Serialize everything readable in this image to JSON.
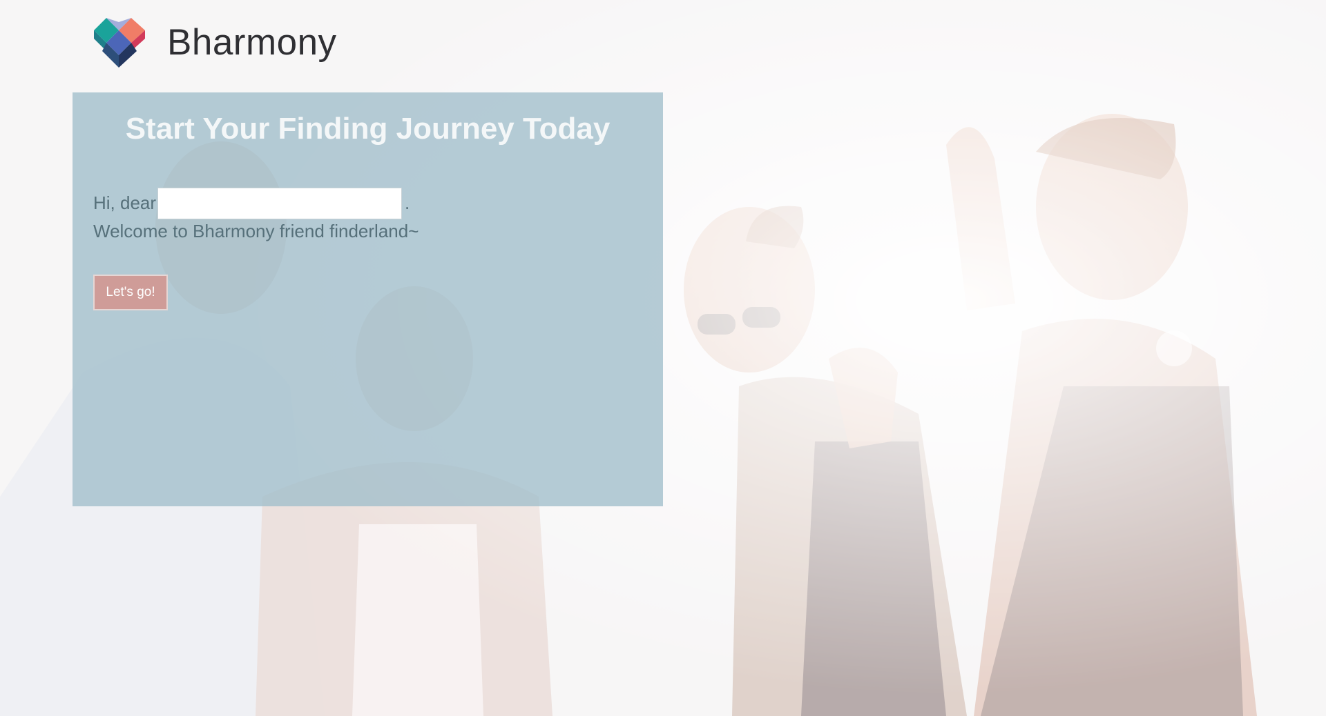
{
  "brand": {
    "name": "Bharmony",
    "logo_icon": "heart-mosaic-icon",
    "colors": {
      "teal": "#1aa39a",
      "blue": "#4c66b8",
      "coral": "#f07d67",
      "crimson": "#d23a5a",
      "navy": "#23365e"
    }
  },
  "panel": {
    "title": "Start Your Finding Journey Today",
    "greeting_prefix": "Hi, dear",
    "greeting_suffix": ".",
    "name_input": {
      "value": "",
      "placeholder": ""
    },
    "welcome_text": "Welcome to Bharmony friend finderland~",
    "go_button_label": "Let's go!"
  },
  "background": {
    "image": "group-of-friends-laughing-photo"
  }
}
